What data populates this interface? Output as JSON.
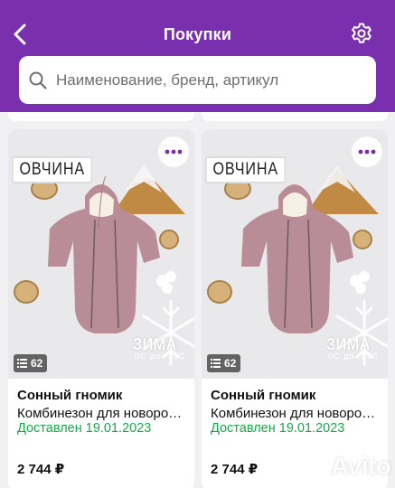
{
  "header": {
    "title": "Покупки"
  },
  "search": {
    "placeholder": "Наименование, бренд, артикул"
  },
  "colors": {
    "header_bg": "#7a2fae",
    "accent": "#7a2fae",
    "status_green": "#1aa84a"
  },
  "icons": [
    "chevron-left-icon",
    "gear-icon",
    "search-icon",
    "more-dots-icon",
    "photos-icon"
  ],
  "products": [
    {
      "photo_count": "62",
      "photo_label_top": "ОВЧИНА",
      "photo_label_season": "ЗИМА",
      "photo_label_temp": "0С до -35С",
      "name": "Сонный гномик",
      "description": "Комбинезон для новорожденного",
      "status": "Доставлен 19.01.2023",
      "price": "2 744 ₽"
    },
    {
      "photo_count": "62",
      "photo_label_top": "ОВЧИНА",
      "photo_label_season": "ЗИМА",
      "photo_label_temp": "0С до -35С",
      "name": "Сонный гномик",
      "description": "Комбинезон для новорожденного",
      "status": "Доставлен 19.01.2023",
      "price": "2 744 ₽"
    }
  ],
  "watermark": {
    "text": "Avito"
  }
}
